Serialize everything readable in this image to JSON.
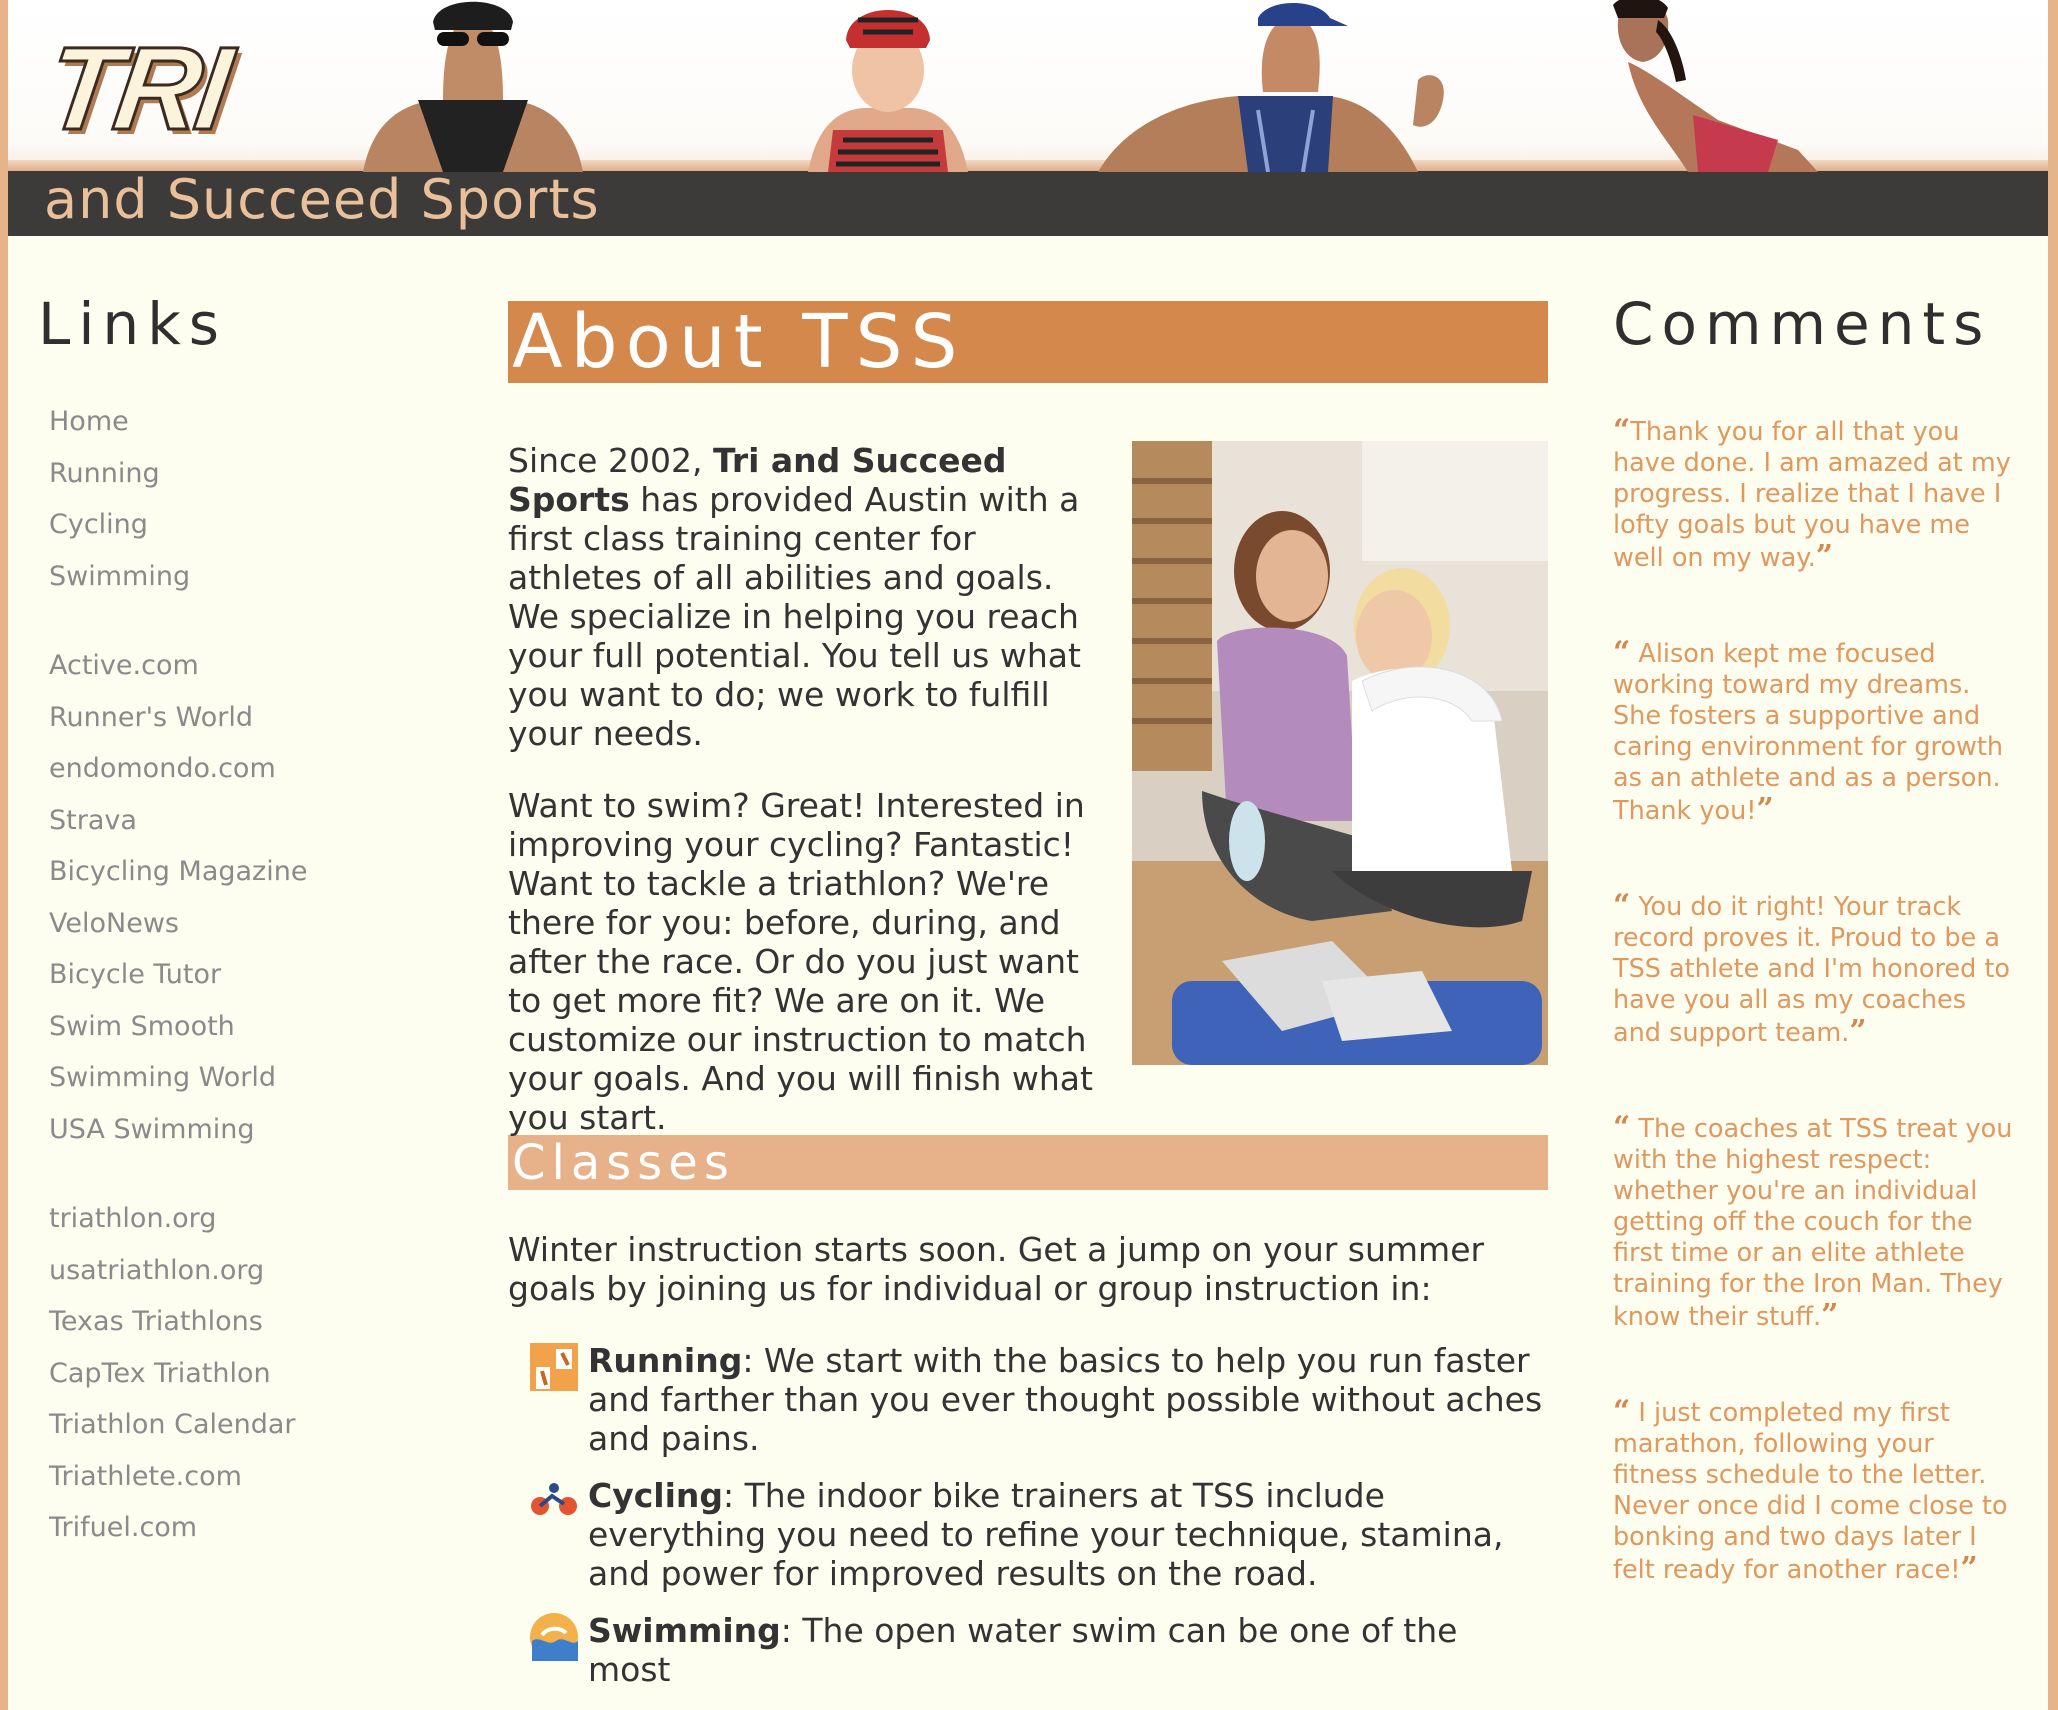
{
  "header": {
    "logo_main": "TRI",
    "logo_sub": "and Succeed Sports",
    "bar_color": "#3d3b3a",
    "accent": "#d5884b"
  },
  "links": {
    "title": "Links",
    "groups": [
      [
        "Home",
        "Running",
        "Cycling",
        "Swimming"
      ],
      [
        "Active.com",
        "Runner's World",
        "endomondo.com",
        "Strava",
        "Bicycling Magazine",
        "VeloNews",
        "Bicycle Tutor",
        "Swim Smooth",
        "Swimming World",
        "USA Swimming"
      ],
      [
        "triathlon.org",
        "usatriathlon.org",
        "Texas Triathlons",
        "CapTex Triathlon",
        "Triathlon Calendar",
        "Triathlete.com",
        "Trifuel.com"
      ]
    ]
  },
  "about": {
    "title": "About TSS",
    "p1_prefix": "Since 2002, ",
    "p1_bold": "Tri and Succeed Sports",
    "p1_rest": " has provided Austin with a first class training center for athletes of all abilities and goals. We specialize in helping you reach your full potential. You tell us what you want to do; we work to fulfill your needs.",
    "p2": "Want to swim? Great! Interested in improving your cycling? Fantastic! Want to tackle a triathlon? We're there for you: before, during, and after the race. Or do you just want to get more fit? We are on it. We customize our instruction to match your goals. And you will finish what you start."
  },
  "classes": {
    "title": "Classes",
    "intro": "Winter instruction starts soon. Get a jump on your summer goals by joining us for individual or group instruction in:",
    "items": [
      {
        "icon": "running-icon",
        "name": "Running",
        "text": ": We start with the basics to help you run faster and farther than you ever thought possible without aches and pains."
      },
      {
        "icon": "cycling-icon",
        "name": "Cycling",
        "text": ": The indoor bike trainers at TSS include everything you need to refine your technique, stamina, and power for improved results on the road."
      },
      {
        "icon": "swimming-icon",
        "name": "Swimming",
        "text": ": The open water swim can be one of the most"
      }
    ]
  },
  "comments": {
    "title": "Comments",
    "open_quote": "“",
    "close_quote": "”",
    "items": [
      "Thank you for all that you have done. I am amazed at my progress. I realize that I have I lofty goals but you have me well on my way.",
      " Alison kept me focused working toward my dreams. She fosters a supportive and caring environment for growth as an athlete and as a person. Thank you!",
      " You do it right! Your track record proves it. Proud to be a TSS athlete and I'm honored to have you all as my coaches and support team.",
      " The coaches at TSS treat you with the highest respect: whether you're an individual getting off the couch for the first time or an elite athlete training for the Iron Man. They know their stuff.",
      " I just completed my first marathon, following your fitness schedule to the letter. Never once did I come close to bonking and two days later I felt ready for another race!"
    ]
  }
}
